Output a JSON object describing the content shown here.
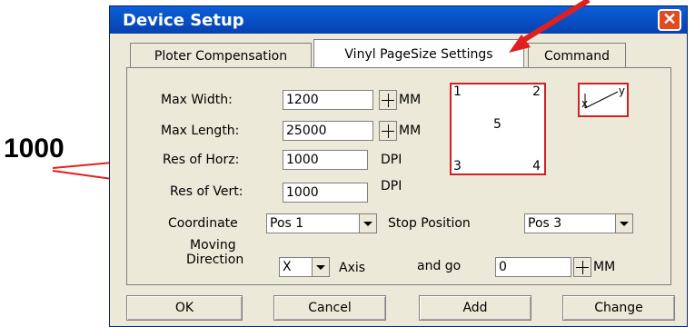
{
  "dialog": {
    "title": "Device Setup",
    "close_glyph": "✕"
  },
  "tabs": [
    {
      "label": "Ploter Compensation"
    },
    {
      "label": "Vinyl PageSize Settings"
    },
    {
      "label": "Command"
    }
  ],
  "form": {
    "max_width": {
      "label": "Max Width:",
      "value": "1200",
      "unit": "MM"
    },
    "max_length": {
      "label": "Max Length:",
      "value": "25000",
      "unit": "MM"
    },
    "res_horz": {
      "label": "Res of Horz:",
      "value": "1000",
      "unit": "DPI"
    },
    "res_vert": {
      "label": "Res of Vert:",
      "value": "1000",
      "unit": "DPI"
    },
    "coordinate": {
      "label": "Coordinate",
      "value": "Pos 1"
    },
    "stop_position": {
      "label": "Stop Position",
      "value": "Pos 3"
    },
    "moving": {
      "label_line1": "Moving",
      "label_line2": "Direction",
      "value": "X",
      "axis_label": "Axis",
      "go_label": "and go",
      "go_value": "0",
      "go_unit": "MM"
    }
  },
  "page_diagram": {
    "c1": "1",
    "c2": "2",
    "c3": "3",
    "c4": "4",
    "center": "5"
  },
  "axis_diagram": {
    "x": "x",
    "y": "y"
  },
  "buttons": {
    "ok": "OK",
    "cancel": "Cancel",
    "add": "Add",
    "change": "Change"
  },
  "annotation": {
    "value": "1000",
    "arrow_color": "#e02020"
  }
}
